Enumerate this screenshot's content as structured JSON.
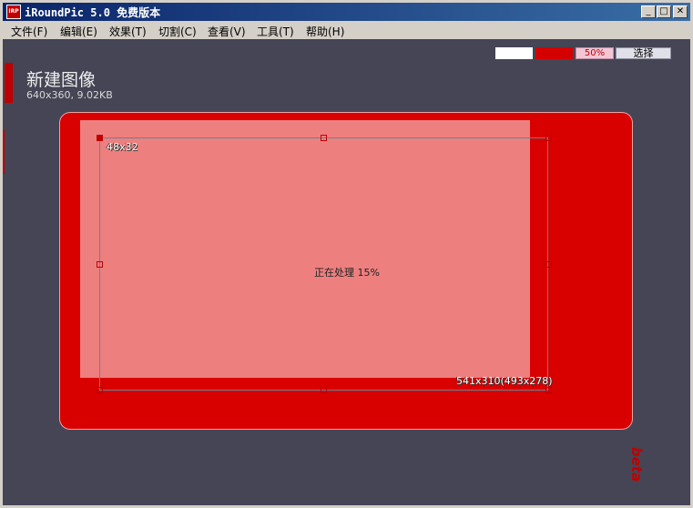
{
  "window": {
    "title": "iRoundPic 5.0 免费版本",
    "icon_text": "IRP",
    "minimize": "_",
    "maximize": "□",
    "close": "✕"
  },
  "menu": {
    "items": [
      {
        "label": "文件(F)"
      },
      {
        "label": "编辑(E)"
      },
      {
        "label": "效果(T)"
      },
      {
        "label": "切割(C)"
      },
      {
        "label": "查看(V)"
      },
      {
        "label": "工具(T)"
      },
      {
        "label": "帮助(H)"
      }
    ]
  },
  "toolbar": {
    "bg_color": "#ffffff",
    "fg_color": "#d40000",
    "zoom": "50%",
    "select_label": "选择"
  },
  "document": {
    "title": "新建图像",
    "meta": "640x360, 9.02KB"
  },
  "selection": {
    "corner_label": "48x32",
    "size_label": "541x310(493x278)"
  },
  "status": {
    "processing": "正在处理 15%"
  },
  "badge": {
    "beta": "beta"
  },
  "colors": {
    "frame": "#d90000",
    "pink": "#ed7f7f",
    "canvas": "#454555"
  }
}
